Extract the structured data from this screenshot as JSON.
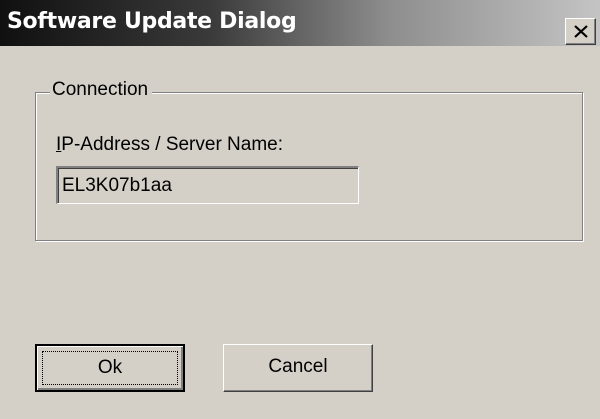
{
  "window": {
    "title": "Software Update Dialog",
    "close_icon": "close-icon"
  },
  "connection_group": {
    "legend": "Connection",
    "field_label_mnemonic": "I",
    "field_label_rest": "P-Address / Server Name:",
    "ip_value": "EL3K07b1aa"
  },
  "buttons": {
    "ok_label": "Ok",
    "cancel_label": "Cancel"
  }
}
